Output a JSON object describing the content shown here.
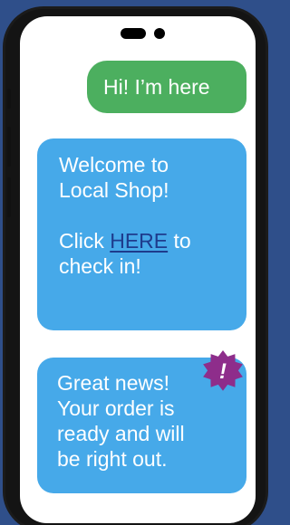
{
  "chat": {
    "outgoing": {
      "text": "Hi! I’m here"
    },
    "welcome": {
      "line1": "Welcome to",
      "line2": "Local Shop!",
      "click_prefix": "Click ",
      "link_text": "HERE",
      "click_suffix": " to",
      "line4": "check in!"
    },
    "news": {
      "line1": "Great news!",
      "line2": "Your order is",
      "line3": "ready and will",
      "line4": "be right out."
    },
    "badge": {
      "icon": "exclamation-badge-icon",
      "symbol": "!"
    }
  },
  "colors": {
    "background": "#2f4f8a",
    "outgoing_bubble": "#4caf5f",
    "incoming_bubble": "#46a9e9",
    "link": "#1e3b8c",
    "badge": "#8e2d8b"
  }
}
